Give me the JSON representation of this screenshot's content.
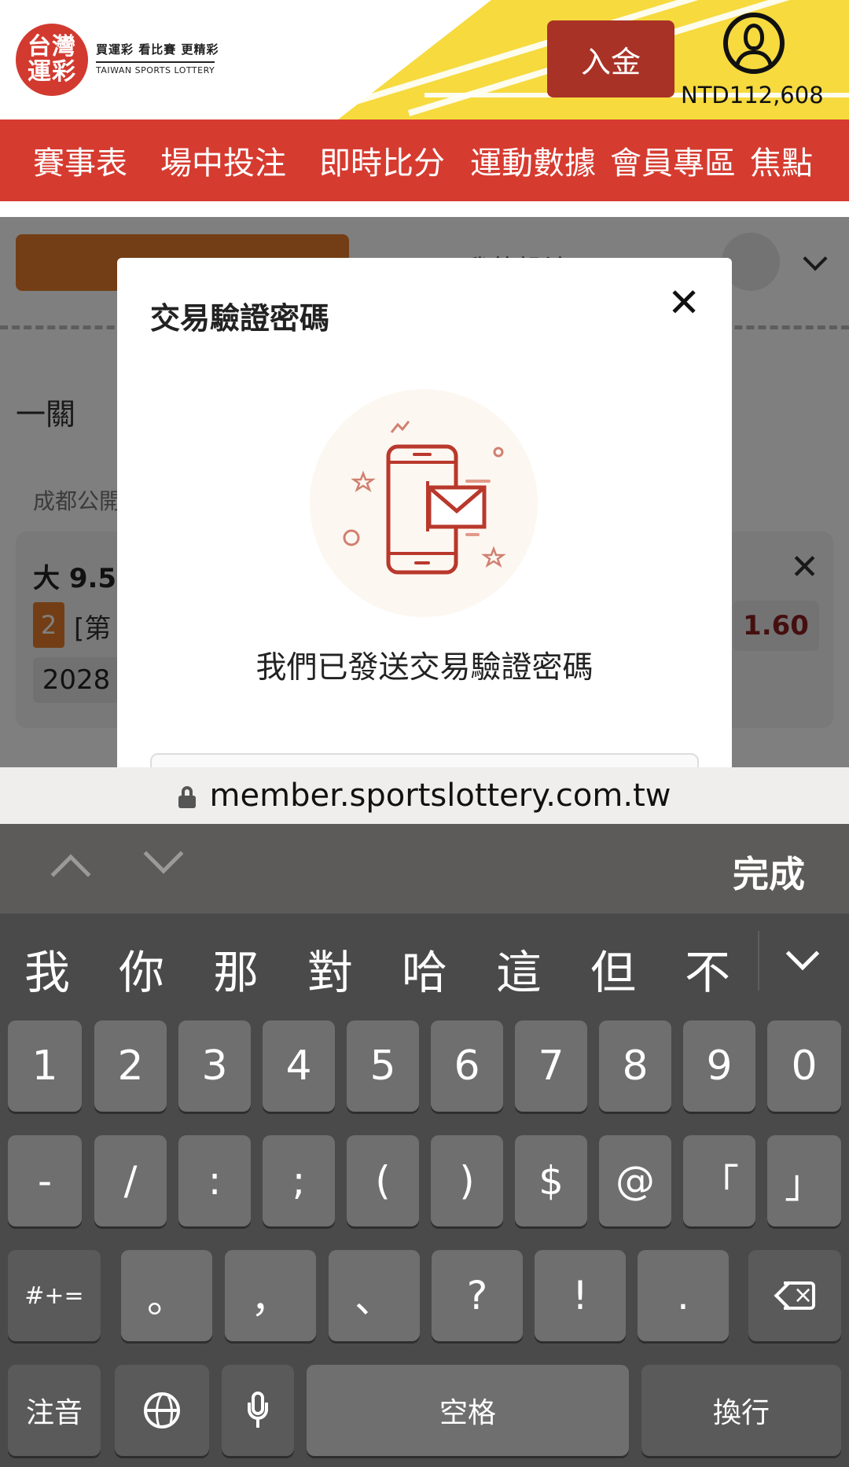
{
  "header": {
    "logo_text_line1": "台灣",
    "logo_text_line2": "運彩",
    "tagline": "買運彩 看比賽 更精彩",
    "tagline_en": "TAIWAN SPORTS LOTTERY",
    "deposit_label": "入金",
    "balance": "NTD112,608",
    "brand_color": "#d63b30",
    "accent_yellow": "#f6da3e"
  },
  "nav": {
    "items": [
      "賽事表",
      "場中投注",
      "即時比分",
      "運動數據",
      "會員專區",
      "焦點"
    ]
  },
  "background": {
    "tab_mine": "我的投注",
    "parlay_label": "一關",
    "team_label": "成都公開",
    "bet_title": "大 9.5",
    "bet_number": "2",
    "bet_bracket": "[第",
    "odds": "1.60",
    "year": "2028"
  },
  "modal": {
    "title": "交易驗證密碼",
    "message": "我們已發送交易驗證密碼",
    "illustration": "phone-envelope-icon"
  },
  "urlbar": {
    "url": "member.sportslottery.com.tw"
  },
  "accessory": {
    "done_label": "完成"
  },
  "keyboard": {
    "candidates": [
      "我",
      "你",
      "那",
      "對",
      "哈",
      "這",
      "但",
      "不"
    ],
    "row1": [
      "1",
      "2",
      "3",
      "4",
      "5",
      "6",
      "7",
      "8",
      "9",
      "0"
    ],
    "row2": [
      "-",
      "/",
      ":",
      ";",
      "(",
      ")",
      "$",
      "@",
      "「",
      "」"
    ],
    "row3": [
      "。",
      "，",
      "、",
      "?",
      "!",
      "."
    ],
    "mode_key": "#+=",
    "zhuyin_key": "注音",
    "space_key": "空格",
    "return_key": "換行"
  }
}
